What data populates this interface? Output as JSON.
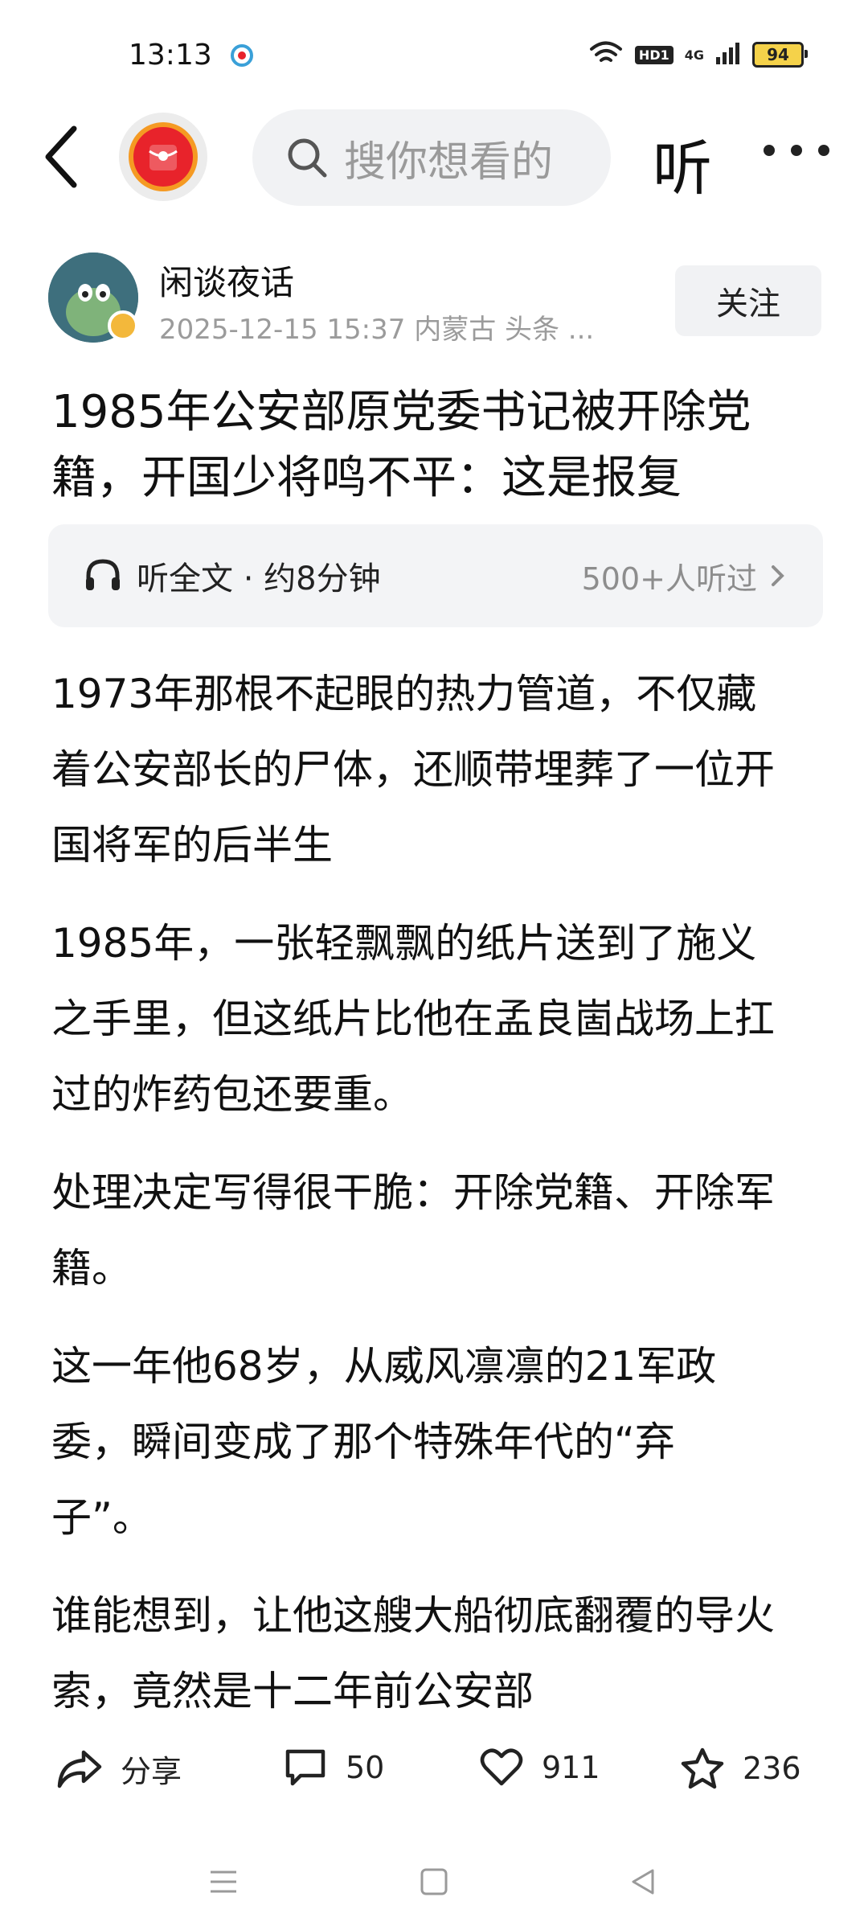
{
  "status_bar": {
    "time": "13:13",
    "hd_label": "HD1",
    "signal_label": "4G",
    "battery": "94"
  },
  "top_nav": {
    "search_placeholder": "搜你想看的",
    "listen_label": "听"
  },
  "author": {
    "name": "闲谈夜话",
    "meta": "2025-12-15  15:37  内蒙古  头条 ...",
    "follow_label": "关注"
  },
  "article": {
    "title": "1985年公安部原党委书记被开除党籍，开国少将鸣不平：这是报复",
    "listen_bar": {
      "label": "听全文 · 约8分钟",
      "count": "500+人听过"
    },
    "paragraphs": [
      "1973年那根不起眼的热力管道，不仅藏着公安部长的尸体，还顺带埋葬了一位开国将军的后半生",
      "1985年，一张轻飘飘的纸片送到了施义之手里，但这纸片比他在孟良崮战场上扛过的炸药包还要重。",
      "处理决定写得很干脆：开除党籍、开除军籍。",
      "这一年他68岁，从威风凛凛的21军政委，瞬间变成了那个特殊年代的“弃子”。",
      "谁能想到，让他这艘大船彻底翻覆的导火索，竟然是十二年前公安部"
    ]
  },
  "actions": {
    "share_label": "分享",
    "comments": "50",
    "likes": "911",
    "favorites": "236"
  },
  "colors": {
    "logo_red": "#e8232b",
    "logo_orange": "#f59a23",
    "battery_yellow": "#f5d24a"
  }
}
